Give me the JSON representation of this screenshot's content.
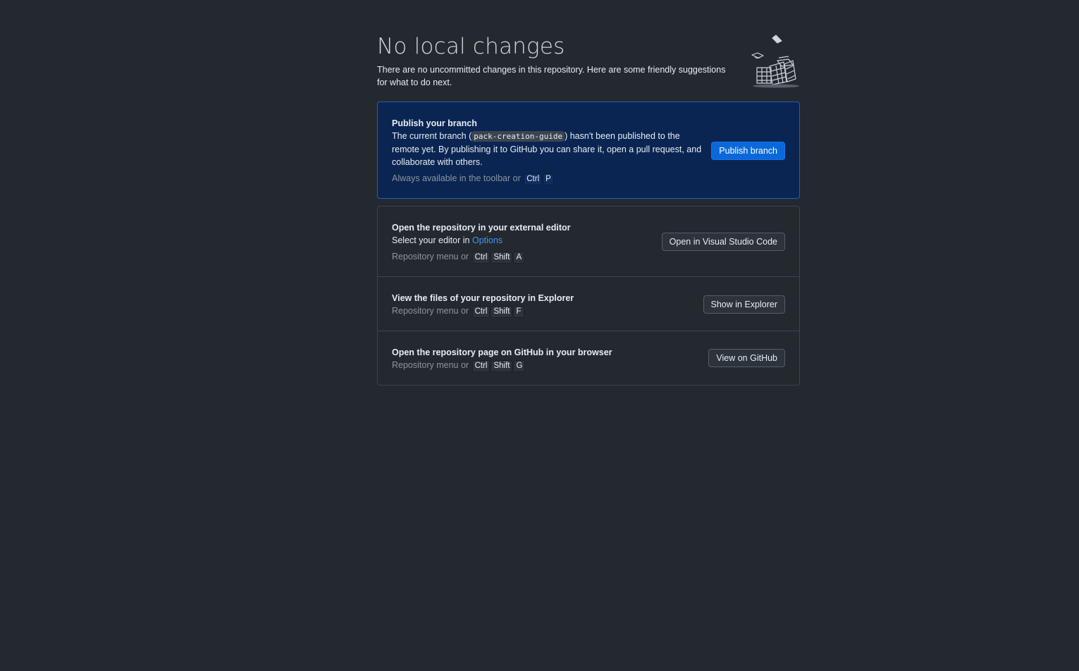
{
  "header": {
    "title": "No local changes",
    "subtitle": "There are no uncommitted changes in this repository. Here are some friendly suggestions for what to do next."
  },
  "publish": {
    "title": "Publish your branch",
    "desc_before": "The current branch (",
    "branch": "pack-creation-guide",
    "desc_after": ") hasn't been published to the remote yet. By publishing it to GitHub you can share it, open a pull request, and collaborate with others.",
    "hint": "Always available in the toolbar or",
    "keys": [
      "Ctrl",
      "P"
    ],
    "button": "Publish branch"
  },
  "editor": {
    "title": "Open the repository in your external editor",
    "desc": "Select your editor in",
    "link": "Options",
    "hint": "Repository menu or",
    "keys": [
      "Ctrl",
      "Shift",
      "A"
    ],
    "button": "Open in Visual Studio Code"
  },
  "explorer": {
    "title": "View the files of your repository in Explorer",
    "hint": "Repository menu or",
    "keys": [
      "Ctrl",
      "Shift",
      "F"
    ],
    "button": "Show in Explorer"
  },
  "github": {
    "title": "Open the repository page on GitHub in your browser",
    "hint": "Repository menu or",
    "keys": [
      "Ctrl",
      "Shift",
      "G"
    ],
    "button": "View on GitHub"
  },
  "colors": {
    "background": "#24292f",
    "accent": "#0969da",
    "link": "#4493f8",
    "publish_card": "#0b2552"
  },
  "icons": {
    "illustration": "empty-repo-illustration-icon"
  }
}
